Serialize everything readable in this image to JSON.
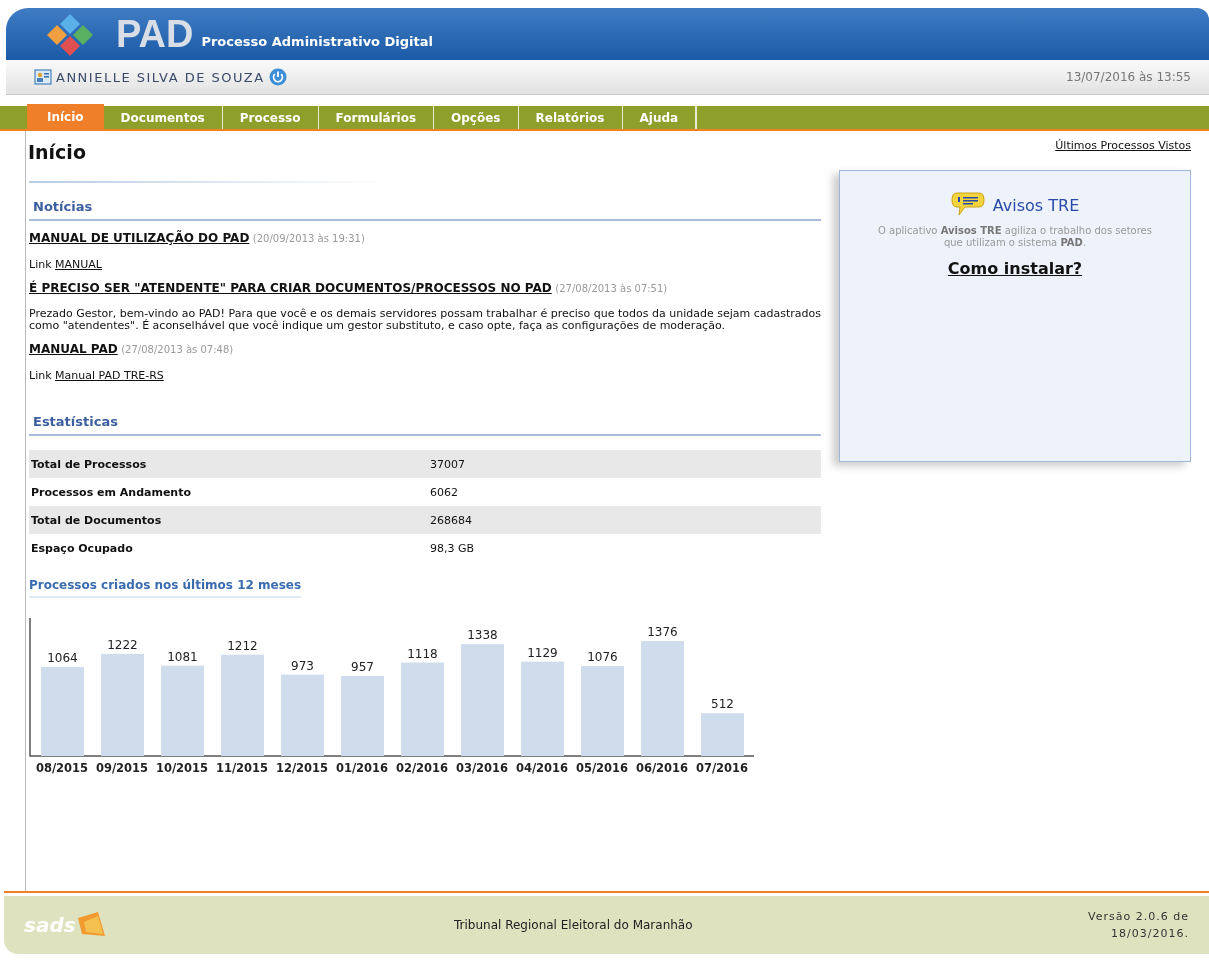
{
  "header": {
    "logo": "PAD",
    "subtitle": "Processo Administrativo Digital",
    "user": "ANNIELLE SILVA DE SOUZA",
    "datetime": "13/07/2016 às 13:55"
  },
  "tabs": [
    {
      "label": "Início",
      "selected": true
    },
    {
      "label": "Documentos",
      "selected": false
    },
    {
      "label": "Processo",
      "selected": false
    },
    {
      "label": "Formulários",
      "selected": false
    },
    {
      "label": "Opções",
      "selected": false
    },
    {
      "label": "Relatórios",
      "selected": false
    },
    {
      "label": "Ajuda",
      "selected": false
    }
  ],
  "page_title": "Início",
  "news": {
    "heading": "Notícias",
    "items": [
      {
        "title": "MANUAL DE UTILIZAÇÃO DO PAD",
        "date": "(20/09/2013 às 19:31)",
        "body": {
          "kind": "link",
          "prefix": "Link",
          "link": "MANUAL"
        }
      },
      {
        "title": "É PRECISO SER \"ATENDENTE\" PARA CRIAR DOCUMENTOS/PROCESSOS NO PAD",
        "date": "(27/08/2013 às 07:51)",
        "body": {
          "kind": "text",
          "text": "Prezado Gestor, bem-vindo ao PAD! Para que você e os demais servidores possam trabalhar é preciso que todos da unidade sejam cadastrados como \"atendentes\". É aconselhável que você indique um gestor substituto, e caso opte, faça as configurações de moderação."
        }
      },
      {
        "title": "MANUAL PAD",
        "date": "(27/08/2013 às 07:48)",
        "body": {
          "kind": "link",
          "prefix": "Link",
          "link": "Manual PAD TRE-RS"
        }
      }
    ]
  },
  "stats": {
    "heading": "Estatísticas",
    "rows": [
      {
        "label": "Total de Processos",
        "value": "37007"
      },
      {
        "label": "Processos em Andamento",
        "value": "6062"
      },
      {
        "label": "Total de Documentos",
        "value": "268684"
      },
      {
        "label": "Espaço Ocupado",
        "value": "98,3 GB"
      }
    ]
  },
  "chart": {
    "heading": "Processos criados nos últimos 12 meses",
    "chart_data": {
      "type": "bar",
      "categories": [
        "08/2015",
        "09/2015",
        "10/2015",
        "11/2015",
        "12/2015",
        "01/2016",
        "02/2016",
        "03/2016",
        "04/2016",
        "05/2016",
        "06/2016",
        "07/2016"
      ],
      "values": [
        1064,
        1222,
        1081,
        1212,
        973,
        957,
        1118,
        1338,
        1129,
        1076,
        1376,
        512
      ],
      "data_labels": true
    }
  },
  "aside": {
    "recent_link": "Últimos Processos Vistos",
    "title": "Avisos TRE",
    "description": "O aplicativo **Avisos TRE** agiliza o trabalho dos setores que utilizam o sistema **PAD**.",
    "install_link": "Como instalar?"
  },
  "footer": {
    "logo": "sads",
    "organization": "Tribunal Regional Eleitoral do Maranhão",
    "version": "Versão 2.0.6 de 18/03/2016."
  }
}
